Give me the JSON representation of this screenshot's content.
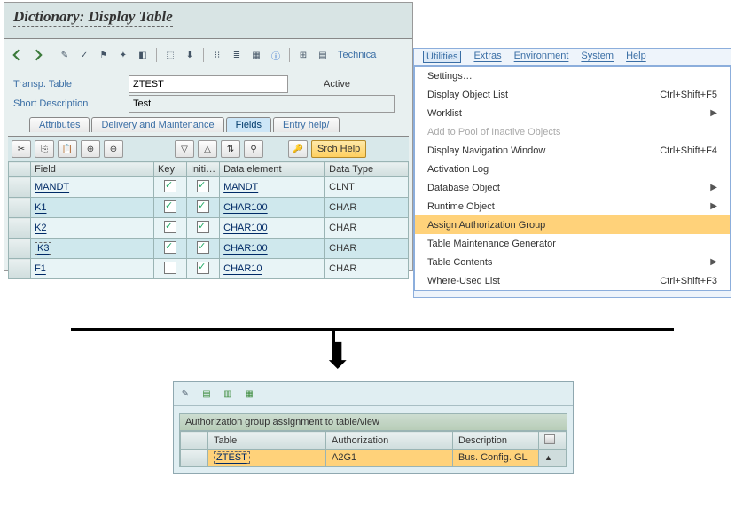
{
  "main": {
    "title": "Dictionary: Display Table",
    "technical_link": "Technica",
    "form": {
      "transp_table_label": "Transp. Table",
      "transp_table_value": "ZTEST",
      "status": "Active",
      "short_desc_label": "Short Description",
      "short_desc_value": "Test"
    },
    "tabs": {
      "attributes": "Attributes",
      "delivery": "Delivery and Maintenance",
      "fields": "Fields",
      "entry": "Entry help/"
    },
    "grid_toolbar": {
      "srch_help": "Srch Help"
    },
    "grid": {
      "headers": {
        "field": "Field",
        "key": "Key",
        "init": "Initi…",
        "elem": "Data element",
        "type": "Data Type"
      },
      "rows": [
        {
          "field": "MANDT",
          "key": true,
          "init": true,
          "elem": "MANDT",
          "type": "CLNT",
          "selected": false
        },
        {
          "field": "K1",
          "key": true,
          "init": true,
          "elem": "CHAR100",
          "type": "CHAR",
          "selected": false
        },
        {
          "field": "K2",
          "key": true,
          "init": true,
          "elem": "CHAR100",
          "type": "CHAR",
          "selected": false
        },
        {
          "field": "K3",
          "key": true,
          "init": true,
          "elem": "CHAR100",
          "type": "CHAR",
          "selected": true
        },
        {
          "field": "F1",
          "key": false,
          "init": true,
          "elem": "CHAR10",
          "type": "CHAR",
          "selected": false
        }
      ]
    }
  },
  "menu": {
    "bar": {
      "utilities": "Utilities",
      "extras": "Extras",
      "env": "Environment",
      "system": "System",
      "help": "Help"
    },
    "items": [
      {
        "label": "Settings…",
        "shortcut": "",
        "submenu": false,
        "disabled": false,
        "hl": false
      },
      {
        "label": "Display Object List",
        "shortcut": "Ctrl+Shift+F5",
        "submenu": false,
        "disabled": false,
        "hl": false
      },
      {
        "label": "Worklist",
        "shortcut": "",
        "submenu": true,
        "disabled": false,
        "hl": false
      },
      {
        "label": "Add to Pool of Inactive Objects",
        "shortcut": "",
        "submenu": false,
        "disabled": true,
        "hl": false
      },
      {
        "label": "Display Navigation Window",
        "shortcut": "Ctrl+Shift+F4",
        "submenu": false,
        "disabled": false,
        "hl": false
      },
      {
        "label": "Activation Log",
        "shortcut": "",
        "submenu": false,
        "disabled": false,
        "hl": false
      },
      {
        "label": "Database Object",
        "shortcut": "",
        "submenu": true,
        "disabled": false,
        "hl": false
      },
      {
        "label": "Runtime Object",
        "shortcut": "",
        "submenu": true,
        "disabled": false,
        "hl": false
      },
      {
        "label": "Assign Authorization Group",
        "shortcut": "",
        "submenu": false,
        "disabled": false,
        "hl": true
      },
      {
        "label": "Table Maintenance Generator",
        "shortcut": "",
        "submenu": false,
        "disabled": false,
        "hl": false
      },
      {
        "label": "Table Contents",
        "shortcut": "",
        "submenu": true,
        "disabled": false,
        "hl": false
      },
      {
        "label": "Where-Used List",
        "shortcut": "Ctrl+Shift+F3",
        "submenu": false,
        "disabled": false,
        "hl": false
      }
    ]
  },
  "bottom": {
    "title": "Authorization group assignment to table/view",
    "headers": {
      "table": "Table",
      "auth": "Authorization",
      "desc": "Description"
    },
    "row": {
      "table": "ZTEST",
      "auth": "A2G1",
      "desc": "Bus. Config. GL"
    }
  }
}
